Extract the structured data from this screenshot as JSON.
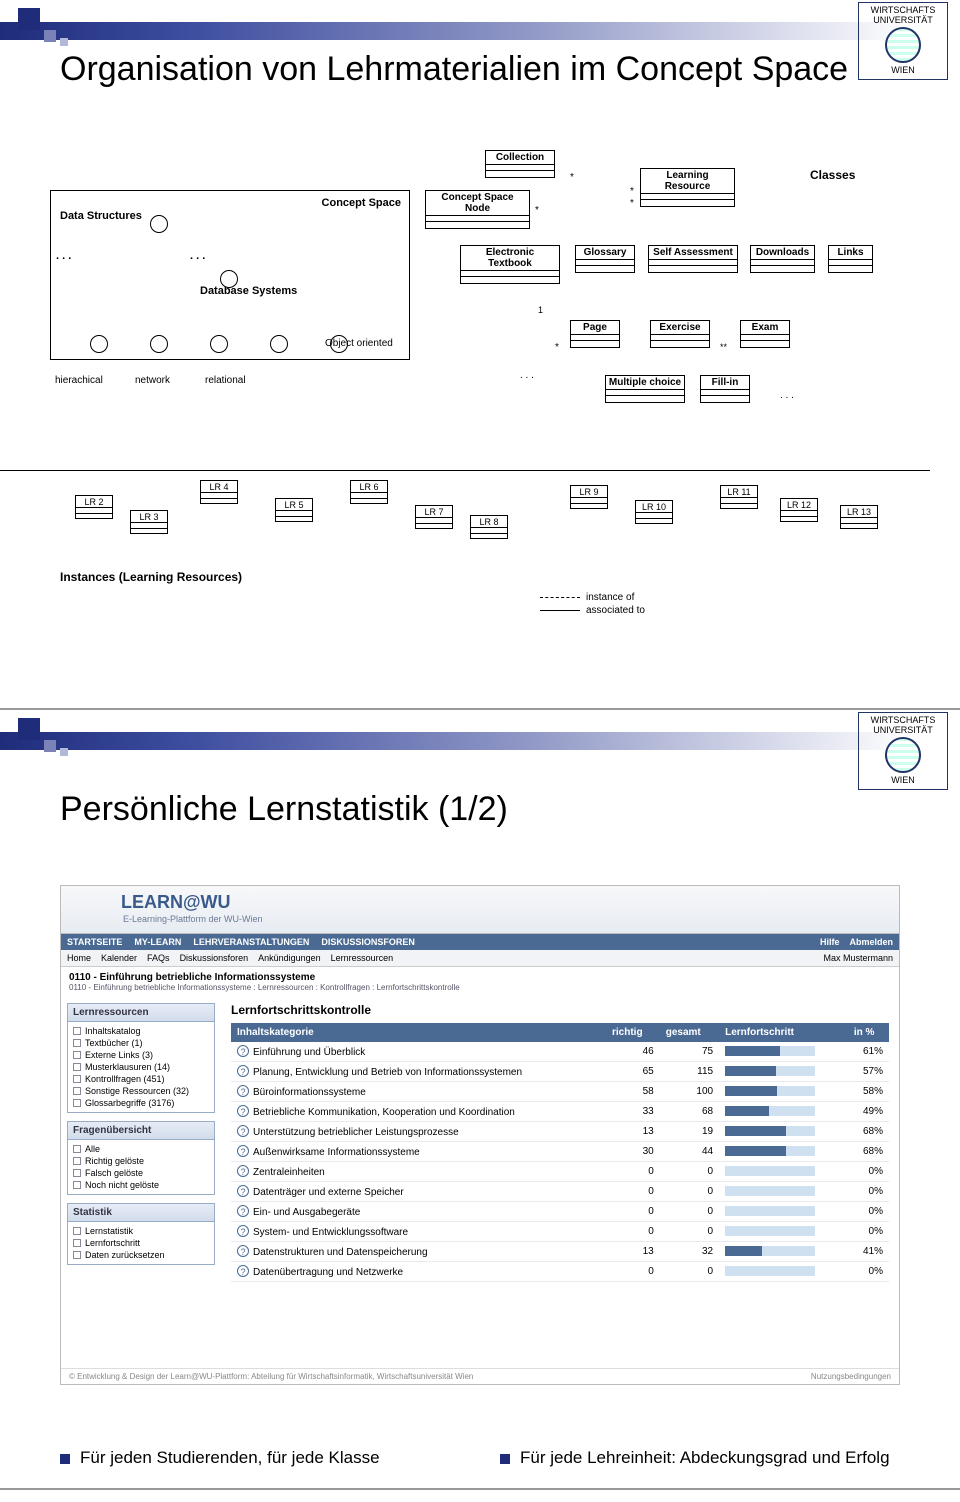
{
  "logo_text": {
    "line1": "WIRTSCHAFTS",
    "line2": "UNIVERSITÄT",
    "city": "WIEN"
  },
  "slide1": {
    "title": "Organisation von Lehrmaterialien im Concept Space",
    "labels": {
      "concept_space": "Concept Space",
      "data_structures": "Data Structures",
      "database_systems": "Database Systems",
      "object_oriented": "Object oriented",
      "hierarchical": "hierachical",
      "network": "network",
      "relational": "relational",
      "collection": "Collection",
      "concept_space_node": "Concept Space Node",
      "learning_resource": "Learning Resource",
      "electronic_textbook": "Electronic Textbook",
      "glossary": "Glossary",
      "self_assessment": "Self Assessment",
      "downloads": "Downloads",
      "links": "Links",
      "page": "Page",
      "exercise": "Exercise",
      "exam": "Exam",
      "multiple_choice": "Multiple choice",
      "fill_in": "Fill-in",
      "classes": "Classes",
      "instances": "Instances (Learning Resources)",
      "instance_of": "instance of",
      "associated_to": "associated to",
      "dots": ". . .",
      "one": "1",
      "star": "*",
      "starstar": "**"
    },
    "lr_boxes": [
      "LR 2",
      "LR 3",
      "LR 4",
      "LR 5",
      "LR 6",
      "LR 7",
      "LR 8",
      "LR 9",
      "LR 10",
      "LR 11",
      "LR 12",
      "LR 13"
    ]
  },
  "slide2": {
    "title": "Persönliche Lernstatistik (1/2)",
    "bullets": [
      "Für jeden Studierenden, für jede Klasse",
      "Für jede Lehreinheit: Abdeckungsgrad und Erfolg"
    ],
    "shot": {
      "brand": "LEARN@WU",
      "brand_sub": "E-Learning-Plattform der WU-Wien",
      "tabs1": [
        "STARTSEITE",
        "MY-LEARN",
        "LEHRVERANSTALTUNGEN",
        "DISKUSSIONSFOREN"
      ],
      "tabs1_right": [
        "Hilfe",
        "Abmelden"
      ],
      "tabs2": [
        "Home",
        "Kalender",
        "FAQs",
        "Diskussionsforen",
        "Ankündigungen",
        "Lernressourcen"
      ],
      "user": "Max Mustermann",
      "breadcrumb_title": "0110 - Einführung betriebliche Informationssysteme",
      "breadcrumb_path": "0110 - Einführung betriebliche Informationssysteme : Lernressourcen : Kontrollfragen : Lernfortschrittskontrolle",
      "main_head": "Lernfortschrittskontrolle",
      "side": {
        "lern": {
          "title": "Lernressourcen",
          "items": [
            "Inhaltskatalog",
            "Textbücher (1)",
            "Externe Links (3)",
            "Musterklausuren (14)",
            "Kontrollfragen (451)",
            "Sonstige Ressourcen (32)",
            "Glossarbegriffe (3176)"
          ]
        },
        "fragen": {
          "title": "Fragenübersicht",
          "items": [
            "Alle",
            "Richtig gelöste",
            "Falsch gelöste",
            "Noch nicht gelöste"
          ]
        },
        "stat": {
          "title": "Statistik",
          "items": [
            "Lernstatistik",
            "Lernfortschritt",
            "Daten zurücksetzen"
          ]
        }
      },
      "table": {
        "headers": [
          "Inhaltskategorie",
          "richtig",
          "gesamt",
          "Lernfortschritt",
          "in %"
        ],
        "rows": [
          {
            "name": "Einführung und Überblick",
            "r": 46,
            "g": 75,
            "p": 61
          },
          {
            "name": "Planung, Entwicklung und Betrieb von Informationssystemen",
            "r": 65,
            "g": 115,
            "p": 57
          },
          {
            "name": "Büroinformationssysteme",
            "r": 58,
            "g": 100,
            "p": 58
          },
          {
            "name": "Betriebliche Kommunikation, Kooperation und Koordination",
            "r": 33,
            "g": 68,
            "p": 49
          },
          {
            "name": "Unterstützung betrieblicher Leistungsprozesse",
            "r": 13,
            "g": 19,
            "p": 68
          },
          {
            "name": "Außenwirksame Informationssysteme",
            "r": 30,
            "g": 44,
            "p": 68
          },
          {
            "name": "Zentraleinheiten",
            "r": 0,
            "g": 0,
            "p": 0
          },
          {
            "name": "Datenträger und externe Speicher",
            "r": 0,
            "g": 0,
            "p": 0
          },
          {
            "name": "Ein- und Ausgabegeräte",
            "r": 0,
            "g": 0,
            "p": 0
          },
          {
            "name": "System- und Entwicklungssoftware",
            "r": 0,
            "g": 0,
            "p": 0
          },
          {
            "name": "Datenstrukturen und Datenspeicherung",
            "r": 13,
            "g": 32,
            "p": 41
          },
          {
            "name": "Datenübertragung und Netzwerke",
            "r": 0,
            "g": 0,
            "p": 0
          }
        ]
      },
      "footer_left": "© Entwicklung & Design der Learn@WU-Plattform: Abteilung für Wirtschaftsinformatik, Wirtschaftsuniversität Wien",
      "footer_right": "Nutzungsbedingungen"
    }
  }
}
